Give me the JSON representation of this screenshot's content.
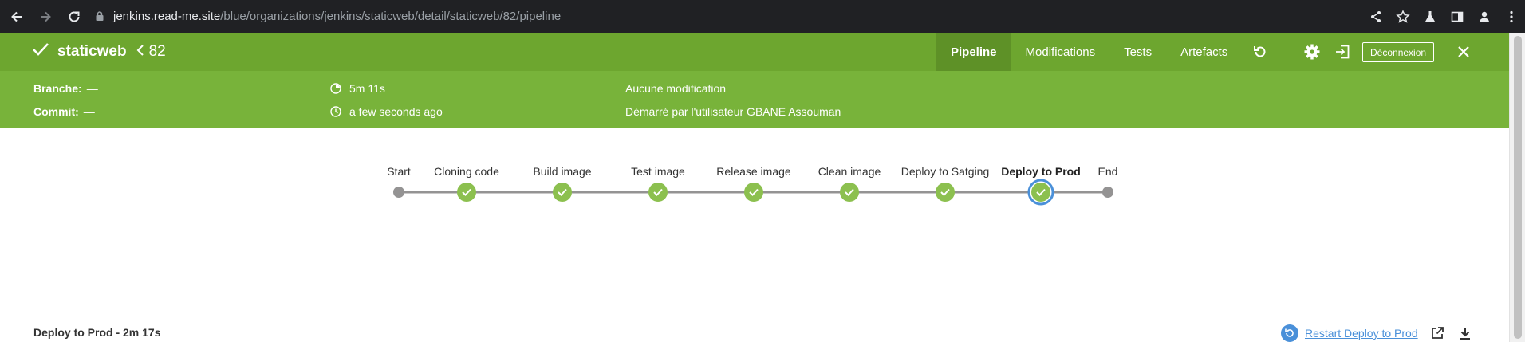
{
  "browser": {
    "url_host": "jenkins.read-me.site",
    "url_path": "/blue/organizations/jenkins/staticweb/detail/staticweb/82/pipeline"
  },
  "run": {
    "job_name": "staticweb",
    "run_number": "82",
    "status_color": "#6da62f",
    "tabs": [
      {
        "label": "Pipeline",
        "active": true
      },
      {
        "label": "Modifications",
        "active": false
      },
      {
        "label": "Tests",
        "active": false
      },
      {
        "label": "Artefacts",
        "active": false
      }
    ],
    "logout_label": "Déconnexion"
  },
  "details": {
    "branch_label": "Branche:",
    "branch_value": "—",
    "commit_label": "Commit:",
    "commit_value": "—",
    "duration": "5m 11s",
    "started": "a few seconds ago",
    "changes": "Aucune modification",
    "started_by": "Démarré par l'utilisateur GBANE Assouman"
  },
  "pipeline": {
    "stages": [
      {
        "label": "Start",
        "kind": "terminal"
      },
      {
        "label": "Cloning code",
        "kind": "success"
      },
      {
        "label": "Build image",
        "kind": "success"
      },
      {
        "label": "Test image",
        "kind": "success"
      },
      {
        "label": "Release image",
        "kind": "success"
      },
      {
        "label": "Clean image",
        "kind": "success"
      },
      {
        "label": "Deploy to Satging",
        "kind": "success"
      },
      {
        "label": "Deploy to Prod",
        "kind": "success",
        "selected": true
      },
      {
        "label": "End",
        "kind": "terminal"
      }
    ],
    "success_color": "#8cc04f",
    "selected_ring_color": "#4a90d9",
    "terminal_color": "#949393"
  },
  "step": {
    "title": "Deploy to Prod - 2m 17s",
    "restart_label": "Restart Deploy to Prod"
  }
}
